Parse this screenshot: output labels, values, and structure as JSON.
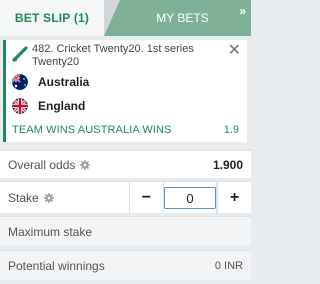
{
  "tabs": {
    "bet_slip": "BET SLIP  (1)",
    "my_bets": "MY BETS",
    "more": "»"
  },
  "selection": {
    "event": "482. Cricket Twenty20. 1st series Twenty20",
    "team1": "Australia",
    "team2": "England",
    "market": "TEAM WINS AUSTRALIA  WINS",
    "odd": "1.9",
    "close": "✕"
  },
  "odds_row": {
    "label": "Overall odds",
    "value": "1.900"
  },
  "stake_row": {
    "label": "Stake",
    "value": "0",
    "minus": "−",
    "plus": "+"
  },
  "max_stake": {
    "label": "Maximum stake"
  },
  "potential": {
    "label": "Potential winnings",
    "value": "0 INR"
  },
  "colors": {
    "accent": "#1e8b5a",
    "tab_inactive": "#7fb098",
    "input_border": "#5a92c8"
  },
  "icons": [
    "pencil-icon",
    "close-icon",
    "australia-flag-icon",
    "england-flag-icon",
    "gear-icon"
  ]
}
